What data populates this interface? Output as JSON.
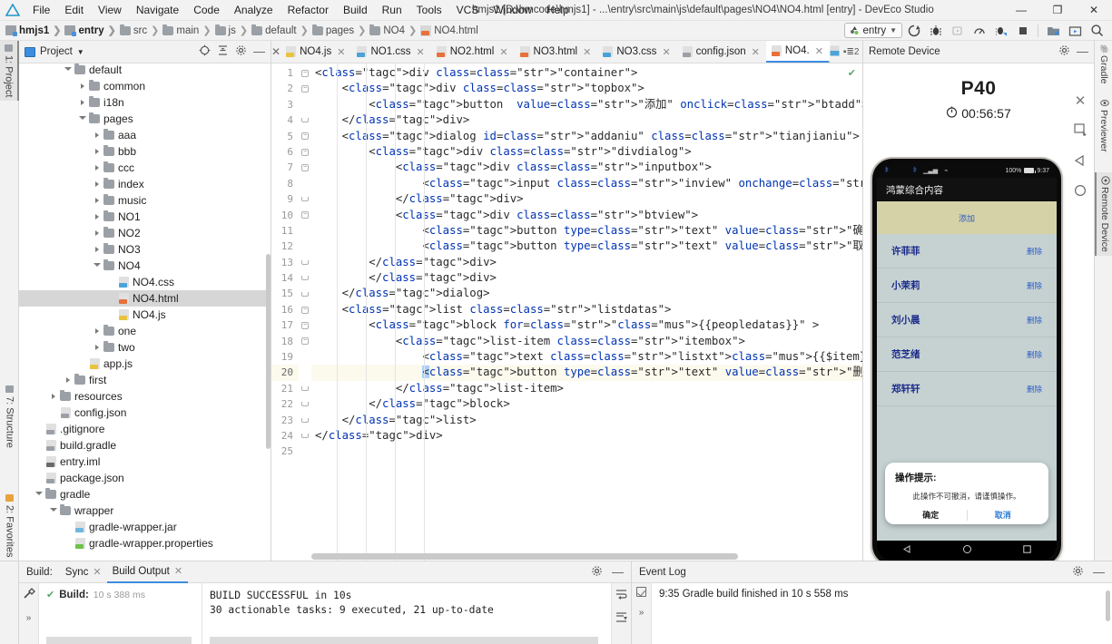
{
  "window": {
    "title": "hmjs1 [D:\\hmcode\\hmjs1] - ...\\entry\\src\\main\\js\\default\\pages\\NO4\\NO4.html [entry] - DevEco Studio",
    "minimize": "—",
    "maximize": "❐",
    "close": "✕"
  },
  "menu": [
    "File",
    "Edit",
    "View",
    "Navigate",
    "Code",
    "Analyze",
    "Refactor",
    "Build",
    "Run",
    "Tools",
    "VCS",
    "Window",
    "Help"
  ],
  "breadcrumb": [
    {
      "label": "hmjs1",
      "icon": "module-icon",
      "bold": true
    },
    {
      "label": "entry",
      "icon": "module-icon",
      "bold": true
    },
    {
      "label": "src",
      "icon": "folder-icon",
      "bold": false
    },
    {
      "label": "main",
      "icon": "folder-icon",
      "bold": false
    },
    {
      "label": "js",
      "icon": "folder-icon",
      "bold": false
    },
    {
      "label": "default",
      "icon": "folder-icon",
      "bold": false
    },
    {
      "label": "pages",
      "icon": "folder-icon",
      "bold": false
    },
    {
      "label": "NO4",
      "icon": "folder-icon",
      "bold": false
    },
    {
      "label": "NO4.html",
      "icon": "html-file-icon",
      "bold": false
    }
  ],
  "toolbar": {
    "run_config": "entry",
    "buttons": [
      "run-icon",
      "debug-icon",
      "attach-debugger-icon",
      "profiler-icon",
      "debug-device-icon",
      "stop-icon",
      "device-manager-icon",
      "previewer-icon",
      "search-icon"
    ]
  },
  "project_panel": {
    "title": "Project",
    "actions": [
      "locate-icon",
      "collapse-all-icon",
      "settings-icon",
      "hide-icon"
    ],
    "tree": [
      {
        "label": "default",
        "depth": 3,
        "arrow": "open",
        "icon": "folder-icon",
        "selected": false,
        "clipped": true
      },
      {
        "label": "common",
        "depth": 4,
        "arrow": "closed",
        "icon": "folder-icon",
        "selected": false
      },
      {
        "label": "i18n",
        "depth": 4,
        "arrow": "closed",
        "icon": "folder-icon",
        "selected": false
      },
      {
        "label": "pages",
        "depth": 4,
        "arrow": "open",
        "icon": "folder-icon",
        "selected": false
      },
      {
        "label": "aaa",
        "depth": 5,
        "arrow": "closed",
        "icon": "folder-icon",
        "selected": false
      },
      {
        "label": "bbb",
        "depth": 5,
        "arrow": "closed",
        "icon": "folder-icon",
        "selected": false
      },
      {
        "label": "ccc",
        "depth": 5,
        "arrow": "closed",
        "icon": "folder-icon",
        "selected": false
      },
      {
        "label": "index",
        "depth": 5,
        "arrow": "closed",
        "icon": "folder-icon",
        "selected": false
      },
      {
        "label": "music",
        "depth": 5,
        "arrow": "closed",
        "icon": "folder-icon",
        "selected": false
      },
      {
        "label": "NO1",
        "depth": 5,
        "arrow": "closed",
        "icon": "folder-icon",
        "selected": false
      },
      {
        "label": "NO2",
        "depth": 5,
        "arrow": "closed",
        "icon": "folder-icon",
        "selected": false
      },
      {
        "label": "NO3",
        "depth": 5,
        "arrow": "closed",
        "icon": "folder-icon",
        "selected": false
      },
      {
        "label": "NO4",
        "depth": 5,
        "arrow": "open",
        "icon": "folder-icon",
        "selected": false
      },
      {
        "label": "NO4.css",
        "depth": 6,
        "arrow": "none",
        "icon": "css-file-icon",
        "selected": false
      },
      {
        "label": "NO4.html",
        "depth": 6,
        "arrow": "none",
        "icon": "html-file-icon",
        "selected": true
      },
      {
        "label": "NO4.js",
        "depth": 6,
        "arrow": "none",
        "icon": "js-file-icon",
        "selected": false
      },
      {
        "label": "one",
        "depth": 5,
        "arrow": "closed",
        "icon": "folder-icon",
        "selected": false
      },
      {
        "label": "two",
        "depth": 5,
        "arrow": "closed",
        "icon": "folder-icon",
        "selected": false
      },
      {
        "label": "app.js",
        "depth": 4,
        "arrow": "none",
        "icon": "js-file-icon",
        "selected": false
      },
      {
        "label": "first",
        "depth": 3,
        "arrow": "closed",
        "icon": "folder-icon",
        "selected": false
      },
      {
        "label": "resources",
        "depth": 2,
        "arrow": "closed",
        "icon": "res-folder-icon",
        "selected": false
      },
      {
        "label": "config.json",
        "depth": 2,
        "arrow": "none",
        "icon": "json-file-icon",
        "selected": false
      },
      {
        "label": ".gitignore",
        "depth": 1,
        "arrow": "none",
        "icon": "git-file-icon",
        "selected": false
      },
      {
        "label": "build.gradle",
        "depth": 1,
        "arrow": "none",
        "icon": "gradle-file-icon",
        "selected": false
      },
      {
        "label": "entry.iml",
        "depth": 1,
        "arrow": "none",
        "icon": "iml-file-icon",
        "selected": false
      },
      {
        "label": "package.json",
        "depth": 1,
        "arrow": "none",
        "icon": "json-file-icon",
        "selected": false
      },
      {
        "label": "gradle",
        "depth": 1,
        "arrow": "open",
        "icon": "folder-icon",
        "selected": false
      },
      {
        "label": "wrapper",
        "depth": 2,
        "arrow": "open",
        "icon": "folder-icon",
        "selected": false
      },
      {
        "label": "gradle-wrapper.jar",
        "depth": 3,
        "arrow": "none",
        "icon": "jar-file-icon",
        "selected": false
      },
      {
        "label": "gradle-wrapper.properties",
        "depth": 3,
        "arrow": "none",
        "icon": "properties-file-icon",
        "selected": false
      }
    ]
  },
  "left_tool_tabs": [
    {
      "label": "1: Project",
      "selected": true
    },
    {
      "label": "7: Structure",
      "selected": false
    },
    {
      "label": "2: Favorites",
      "selected": false
    }
  ],
  "right_tool_tabs": [
    {
      "label": "Gradle",
      "selected": false,
      "icon": "gradle-icon"
    },
    {
      "label": "Previewer",
      "selected": false,
      "icon": "eye-icon"
    },
    {
      "label": "Remote Device",
      "selected": true,
      "icon": "remote-device-icon"
    }
  ],
  "editor": {
    "tabs": [
      {
        "label": "NO4.js",
        "icon": "js-file-icon",
        "active": false
      },
      {
        "label": "NO1.css",
        "icon": "css-file-icon",
        "active": false
      },
      {
        "label": "NO2.html",
        "icon": "html-file-icon",
        "active": false
      },
      {
        "label": "NO3.html",
        "icon": "html-file-icon",
        "active": false
      },
      {
        "label": "NO3.css",
        "icon": "css-file-icon",
        "active": false
      },
      {
        "label": "config.json",
        "icon": "json-file-icon",
        "active": false
      },
      {
        "label": "NO4.",
        "icon": "html-file-icon",
        "active": true
      }
    ],
    "tab_close_glyph": "✕",
    "tab_overflow_label": "2",
    "inspection_status": "✔",
    "current_line": 20,
    "lines": [
      {
        "n": 1,
        "indent": 0,
        "fold": "open"
      },
      {
        "n": 2,
        "indent": 1,
        "fold": "open"
      },
      {
        "n": 3,
        "indent": 2,
        "fold": "none"
      },
      {
        "n": 4,
        "indent": 1,
        "fold": "end"
      },
      {
        "n": 5,
        "indent": 1,
        "fold": "open"
      },
      {
        "n": 6,
        "indent": 2,
        "fold": "open"
      },
      {
        "n": 7,
        "indent": 3,
        "fold": "open"
      },
      {
        "n": 8,
        "indent": 4,
        "fold": "none"
      },
      {
        "n": 9,
        "indent": 3,
        "fold": "end"
      },
      {
        "n": 10,
        "indent": 3,
        "fold": "open"
      },
      {
        "n": 11,
        "indent": 4,
        "fold": "none"
      },
      {
        "n": 12,
        "indent": 4,
        "fold": "none"
      },
      {
        "n": 13,
        "indent": 2,
        "fold": "end"
      },
      {
        "n": 14,
        "indent": 2,
        "fold": "end"
      },
      {
        "n": 15,
        "indent": 1,
        "fold": "end"
      },
      {
        "n": 16,
        "indent": 1,
        "fold": "open"
      },
      {
        "n": 17,
        "indent": 2,
        "fold": "open"
      },
      {
        "n": 18,
        "indent": 3,
        "fold": "open"
      },
      {
        "n": 19,
        "indent": 4,
        "fold": "none"
      },
      {
        "n": 20,
        "indent": 4,
        "fold": "none"
      },
      {
        "n": 21,
        "indent": 3,
        "fold": "end"
      },
      {
        "n": 22,
        "indent": 2,
        "fold": "end"
      },
      {
        "n": 23,
        "indent": 1,
        "fold": "end"
      },
      {
        "n": 24,
        "indent": 0,
        "fold": "end"
      },
      {
        "n": 25,
        "indent": 0,
        "fold": "none"
      }
    ],
    "source_text": [
      "<div class=\"container\">",
      "    <div class=\"topbox\">",
      "        <button  value=\"添加\" onclick=\"btadd\"></button>",
      "    </div>",
      "    <dialog id=\"addaniu\" class=\"tianjianiu\">",
      "        <div class=\"divdialog\">",
      "            <div class=\"inputbox\">",
      "                <input class=\"inview\" onchange=\"chaname\" id=\"inputname\" type=\"text\" placeholder=\"请输",
      "            </div>",
      "            <div class=\"btview\">",
      "                <button type=\"text\" value=\"确定\" onclick=\"tjyes\"></button>",
      "                <button type=\"text\" value=\"取消\"></button>",
      "        </div>",
      "        </div>",
      "    </dialog>",
      "    <list class=\"listdatas\">",
      "        <block for=\"{{peopledatas}}\" >",
      "            <list-item class=\"itembox\">",
      "                <text class=\"listxt\">{{$item}}</text>",
      "                <button type=\"text\" value=\"删除\" onclick=\"btdel($idx)\"></button>",
      "            </list-item>",
      "        </block>",
      "    </list>",
      "</div>",
      ""
    ]
  },
  "device_panel": {
    "header_title": "Remote Device",
    "header_actions": [
      "settings-icon",
      "hide-icon"
    ],
    "device_name": "P40",
    "timer": "00:56:57",
    "timer_icon": "stopwatch-icon",
    "side_actions": [
      "close-icon",
      "screenshot-icon",
      "back-icon",
      "home-icon"
    ],
    "phone": {
      "status_bar": {
        "battery": "100%",
        "time": "9:37",
        "icons": [
          "bluetooth-icon",
          "bluetooth-icon",
          "signal-icon",
          "wifi-icon"
        ]
      },
      "app_title": "鸿蒙综合内容",
      "add_button": "添加",
      "list": [
        {
          "name": "许菲菲",
          "action": "删除"
        },
        {
          "name": "小茉莉",
          "action": "删除"
        },
        {
          "name": "刘小晨",
          "action": "删除"
        },
        {
          "name": "范芝绪",
          "action": "删除"
        },
        {
          "name": "郑轩轩",
          "action": "删除"
        }
      ],
      "dialog": {
        "title": "操作提示:",
        "message": "此操作不可撤消，请谨慎操作。",
        "confirm": "确定",
        "cancel": "取消"
      },
      "nav_buttons": [
        "back-nav-icon",
        "home-nav-icon",
        "recents-nav-icon"
      ]
    }
  },
  "bottom": {
    "build": {
      "label": "Build:",
      "tabs": [
        {
          "label": "Sync",
          "active": false
        },
        {
          "label": "Build Output",
          "active": true
        }
      ],
      "actions": [
        "settings-icon",
        "hide-icon"
      ],
      "tree_status": "Build:",
      "tree_time": "10 s 388 ms",
      "log": [
        "BUILD SUCCESSFUL in 10s",
        "30 actionable tasks: 9 executed, 21 up-to-date"
      ]
    },
    "event_log": {
      "title": "Event Log",
      "actions": [
        "settings-icon",
        "hide-icon"
      ],
      "entries": [
        "9:35 Gradle build finished in 10 s 558 ms"
      ]
    }
  },
  "colors": {
    "accent": "#3c8de0",
    "success": "#59a869",
    "phone_list_bg": "#c6d2d2",
    "phone_addbar_bg": "#d6d2a8",
    "phone_name_color": "#1b2a8a",
    "current_line_bg": "#fcfaed"
  }
}
